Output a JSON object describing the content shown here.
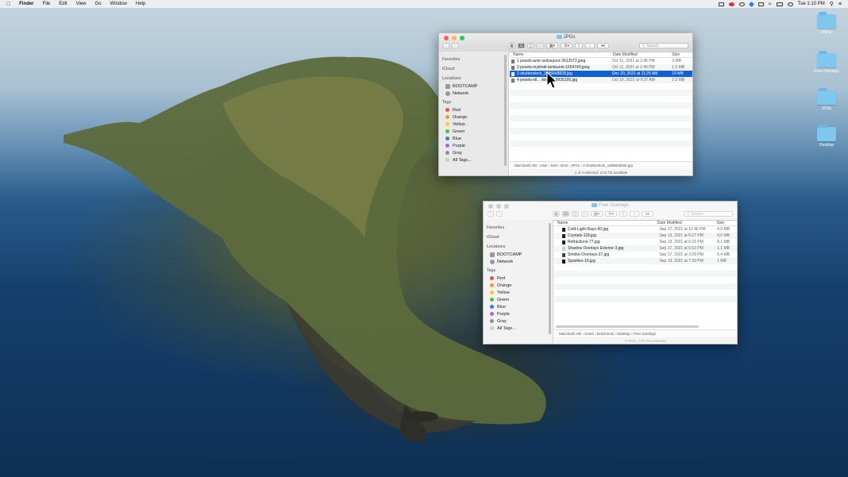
{
  "menubar": {
    "app": "Finder",
    "items": [
      "File",
      "Edit",
      "View",
      "Go",
      "Window",
      "Help"
    ],
    "clock": "Tue 1:10 PM"
  },
  "desktop_icons": [
    {
      "label": "PSDs"
    },
    {
      "label": "Free Overlays"
    },
    {
      "label": "JPGs"
    },
    {
      "label": "Desktop"
    }
  ],
  "window1": {
    "title": "JPGs",
    "search_placeholder": "Search",
    "sidebar": {
      "favorites_head": "Favorites",
      "icloud_head": "iCloud",
      "locations_head": "Locations",
      "locations": [
        "BOOTCAMP",
        "Network"
      ],
      "tags_head": "Tags",
      "tags": [
        {
          "label": "Red",
          "color": "#f04e45"
        },
        {
          "label": "Orange",
          "color": "#f59a23"
        },
        {
          "label": "Yellow",
          "color": "#f3cd2c"
        },
        {
          "label": "Green",
          "color": "#4cc14a"
        },
        {
          "label": "Blue",
          "color": "#2f7cf6"
        },
        {
          "label": "Purple",
          "color": "#b163d6"
        },
        {
          "label": "Gray",
          "color": "#8e8e93"
        }
      ],
      "all_tags": "All Tags..."
    },
    "columns": {
      "name": "Name",
      "date": "Date Modified",
      "size": "Size"
    },
    "rows": [
      {
        "name": "1 pexels-amir-seilsepour-3912572.jpeg",
        "date": "Oct 11, 2021 at 1:46 PM",
        "size": "3 MB"
      },
      {
        "name": "2 pexels-mykhail-tamburini-1654740.jpeg",
        "date": "Oct 11, 2021 at 1:46 PM",
        "size": "1.9 MB"
      },
      {
        "name": "3 shutterstock_1695648828.jpg",
        "date": "Dec 20, 2021 at 11:25 AM",
        "size": "19 MB"
      },
      {
        "name": "4 pexels-ell... donnell-9935195.jpg",
        "date": "Oct 19, 2021 at 9:37 AM",
        "size": "2.2 MB"
      }
    ],
    "selected_index": 2,
    "path": [
      "Macintosh HD",
      "User",
      "keiri",
      "Desi",
      "JPGs",
      "3 shutterstock_1695648828.jpg"
    ],
    "status": "1 of 4 selected, 3.04 TB available"
  },
  "window2": {
    "title": "Free Overlays",
    "search_placeholder": "Search",
    "sidebar": {
      "favorites_head": "Favorites",
      "icloud_head": "iCloud",
      "locations_head": "Locations",
      "locations": [
        "BOOTCAMP",
        "Network"
      ],
      "tags_head": "Tags",
      "tags": [
        {
          "label": "Red",
          "color": "#f04e45"
        },
        {
          "label": "Orange",
          "color": "#f59a23"
        },
        {
          "label": "Yellow",
          "color": "#f3cd2c"
        },
        {
          "label": "Green",
          "color": "#4cc14a"
        },
        {
          "label": "Blue",
          "color": "#2f7cf6"
        },
        {
          "label": "Purple",
          "color": "#b163d6"
        },
        {
          "label": "Gray",
          "color": "#8e8e93"
        }
      ],
      "all_tags": "All Tags..."
    },
    "columns": {
      "name": "Name",
      "date": "Date Modified",
      "size": "Size"
    },
    "rows": [
      {
        "name": "Cold-Light-Rays-60.jpg",
        "date": "Sep 17, 2021 at 12:46 PM",
        "size": "4.9 MB"
      },
      {
        "name": "Crystals-118.jpg",
        "date": "Sep 13, 2021 at 6:27 PM",
        "size": "9.6 MB"
      },
      {
        "name": "Refractions-77.jpg",
        "date": "Sep 13, 2021 at 6:31 PM",
        "size": "8.1 MB"
      },
      {
        "name": "Shadow Overlays Exterior-3.jpg",
        "date": "Sep 17, 2021 at 6:53 PM",
        "size": "1.1 MB"
      },
      {
        "name": "Smoke-Overlays-37.jpg",
        "date": "Sep 17, 2021 at 3:29 PM",
        "size": "6.4 MB"
      },
      {
        "name": "Sparkles-16.jpg",
        "date": "Sep 13, 2021 at 7:39 PM",
        "size": "1 MB"
      }
    ],
    "path": [
      "Macintosh HD",
      "Users",
      "kelvinmoni",
      "Desktop",
      "Free Overlays"
    ],
    "status": "6 items, 3.04 TB available"
  }
}
